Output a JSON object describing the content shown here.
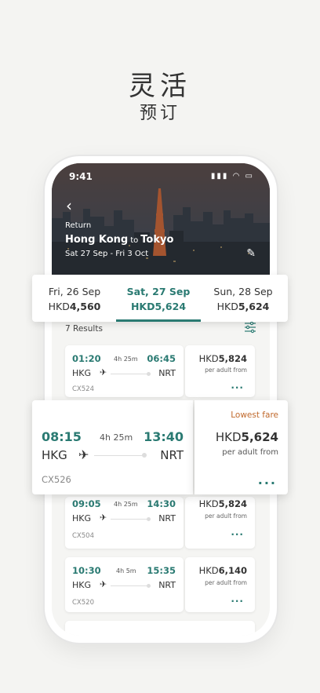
{
  "headline": {
    "line1": "灵活",
    "line2": "预订"
  },
  "status": {
    "time": "9:41"
  },
  "hero": {
    "trip_type": "Return",
    "origin": "Hong Kong",
    "to": "to",
    "destination": "Tokyo",
    "dates": "Sat 27 Sep - Fri 3 Oct"
  },
  "date_strip": [
    {
      "day": "Fri, 26 Sep",
      "currency": "HKD",
      "amount": "4,560",
      "active": false
    },
    {
      "day": "Sat, 27 Sep",
      "currency": "HKD",
      "amount": "5,624",
      "active": true
    },
    {
      "day": "Sun, 28 Sep",
      "currency": "HKD",
      "amount": "5,624",
      "active": false
    }
  ],
  "results": {
    "count_label": "7 Results"
  },
  "flights": [
    {
      "dep_time": "01:20",
      "duration": "4h 25m",
      "arr_time": "06:45",
      "from": "HKG",
      "to": "NRT",
      "flight_no": "CX524",
      "currency": "HKD",
      "amount": "5,824",
      "per": "per adult from",
      "more": "..."
    },
    {
      "dep_time": "08:15",
      "duration": "4h 25m",
      "arr_time": "13:40",
      "from": "HKG",
      "to": "NRT",
      "flight_no": "CX526",
      "currency": "HKD",
      "amount": "5,624",
      "per": "per adult from",
      "more": "...",
      "badge": "Lowest fare"
    },
    {
      "dep_time": "09:05",
      "duration": "4h 25m",
      "arr_time": "14:30",
      "from": "HKG",
      "to": "NRT",
      "flight_no": "CX504",
      "currency": "HKD",
      "amount": "5,824",
      "per": "per adult from",
      "more": "..."
    },
    {
      "dep_time": "10:30",
      "duration": "4h 5m",
      "arr_time": "15:35",
      "from": "HKG",
      "to": "NRT",
      "flight_no": "CX520",
      "currency": "HKD",
      "amount": "6,140",
      "per": "per adult from",
      "more": "..."
    }
  ],
  "colors": {
    "accent": "#2a7a72",
    "lowest_fare": "#c0692c"
  }
}
